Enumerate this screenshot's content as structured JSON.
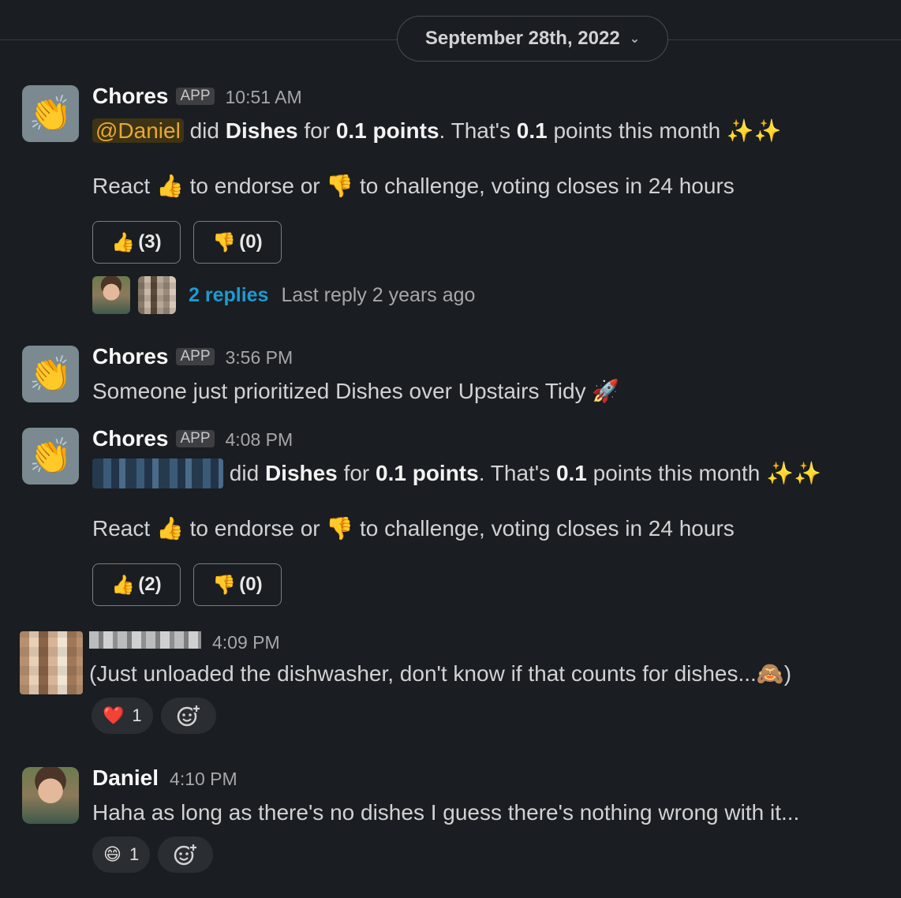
{
  "date_divider": {
    "label": "September 28th, 2022"
  },
  "app_badge": "APP",
  "messages": [
    {
      "sender": "Chores",
      "time": "10:51 AM",
      "mention": "@Daniel",
      "text_a": "did",
      "chore": "Dishes",
      "text_b": "for",
      "points": "0.1 points",
      "text_c": ". That's",
      "month_points": "0.1",
      "text_d": "points this month",
      "sparkles": "✨✨",
      "react_a": "React",
      "react_b": "to endorse or",
      "react_c": "to challenge, voting closes in 24 hours",
      "endorse_count": "(3)",
      "challenge_count": "(0)",
      "replies_label": "2 replies",
      "last_reply": "Last reply 2 years ago"
    },
    {
      "sender": "Chores",
      "time": "3:56 PM",
      "text": "Someone just prioritized Dishes over Upstairs Tidy",
      "emoji": "🚀"
    },
    {
      "sender": "Chores",
      "time": "4:08 PM",
      "text_a": "did",
      "chore": "Dishes",
      "text_b": "for",
      "points": "0.1 points",
      "text_c": ". That's",
      "month_points": "0.1",
      "text_d": "points this month",
      "sparkles": "✨✨",
      "react_a": "React",
      "react_b": "to endorse or",
      "react_c": "to challenge, voting closes in 24 hours",
      "endorse_count": "(2)",
      "challenge_count": "(0)"
    },
    {
      "time": "4:09 PM",
      "text": "(Just unloaded the dishwasher, don't know if that counts for dishes...",
      "emoji": "🙈",
      "text_end": ")",
      "reaction_emoji": "❤️",
      "reaction_count": "1"
    },
    {
      "sender": "Daniel",
      "time": "4:10 PM",
      "text": "Haha as long as there's no dishes I guess there's nothing wrong with it...",
      "reaction_emoji": "😄",
      "reaction_count": "1"
    }
  ],
  "icons": {
    "thumbs_up": "👍",
    "thumbs_down": "👎",
    "app_avatar": "👏",
    "add_reaction": "add-reaction-icon",
    "chevron": "⌄"
  },
  "colors": {
    "background": "#1a1d21",
    "link": "#1d9bd1",
    "mention_text": "#e8a92f",
    "mention_bg": "#3e3314"
  }
}
